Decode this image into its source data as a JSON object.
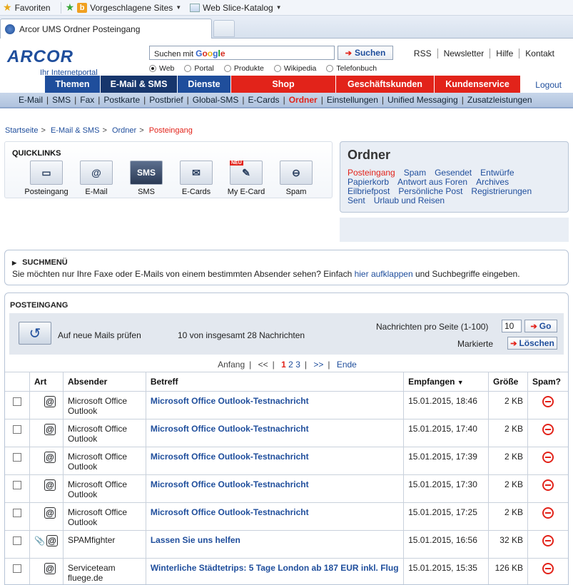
{
  "browser": {
    "favorites_label": "Favoriten",
    "suggested_sites": "Vorgeschlagene Sites",
    "web_slice": "Web Slice-Katalog",
    "tab_title": "Arcor UMS Ordner Posteingang"
  },
  "header": {
    "logo_text": "ARCOR",
    "logo_sub": "Ihr Internetportal",
    "search_prefix": "Suchen mit",
    "search_button": "Suchen",
    "radios": [
      "Web",
      "Portal",
      "Produkte",
      "Wikipedia",
      "Telefonbuch"
    ],
    "radio_selected": "Web",
    "top_links": [
      "RSS",
      "Newsletter",
      "Hilfe",
      "Kontakt"
    ],
    "nav": [
      "Themen",
      "E-Mail & SMS",
      "Dienste",
      "Shop",
      "Geschäftskunden",
      "Kundenservice"
    ],
    "logout": "Logout",
    "subnav": [
      "E-Mail",
      "SMS",
      "Fax",
      "Postkarte",
      "Postbrief",
      "Global-SMS",
      "E-Cards",
      "Ordner",
      "Einstellungen",
      "Unified Messaging",
      "Zusatzleistungen"
    ],
    "subnav_selected": "Ordner"
  },
  "breadcrumb": [
    "Startseite",
    "E-Mail & SMS",
    "Ordner",
    "Posteingang"
  ],
  "quicklinks": {
    "title": "QUICKLINKS",
    "items": [
      {
        "label": "Posteingang",
        "icon": "inbox-icon"
      },
      {
        "label": "E-Mail",
        "icon": "email-icon"
      },
      {
        "label": "SMS",
        "icon": "sms-icon"
      },
      {
        "label": "E-Cards",
        "icon": "ecard-icon"
      },
      {
        "label": "My E-Card",
        "icon": "my-ecard-icon",
        "badge": "NEU"
      },
      {
        "label": "Spam",
        "icon": "spam-icon"
      }
    ]
  },
  "ordner": {
    "title": "Ordner",
    "folders": [
      "Posteingang",
      "Spam",
      "Gesendet",
      "Entwürfe",
      "Papierkorb",
      "Antwort aus Foren",
      "Archives",
      "Eilbriefpost",
      "Persönliche Post",
      "Registrierungen",
      "Sent",
      "Urlaub und Reisen"
    ],
    "current": "Posteingang"
  },
  "suchmenu": {
    "title": "SUCHMENÜ",
    "text_before": "Sie möchten nur Ihre Faxe oder E-Mails von einem bestimmten Absender sehen? Einfach",
    "link": "hier aufklappen",
    "text_after": "und Suchbegriffe eingeben."
  },
  "inbox": {
    "title": "POSTEINGANG",
    "check_label": "Auf neue Mails prüfen",
    "count_text": "10 von insgesamt 28 Nachrichten",
    "per_page_label": "Nachrichten pro Seite (1-100)",
    "per_page_value": "10",
    "go_button": "Go",
    "marked_label": "Markierte",
    "delete_button": "Löschen",
    "pager": {
      "first": "Anfang",
      "prev": "<<",
      "pages": [
        "1",
        "2",
        "3"
      ],
      "current": "1",
      "next": ">>",
      "last": "Ende"
    },
    "columns": [
      "Art",
      "Absender",
      "Betreff",
      "Empfangen",
      "Größe",
      "Spam?"
    ],
    "sorted_column": "Empfangen",
    "rows": [
      {
        "attachment": false,
        "sender": "Microsoft Office Outlook",
        "subject": "Microsoft Office Outlook-Testnachricht",
        "received": "15.01.2015, 18:46",
        "size": "2 KB"
      },
      {
        "attachment": false,
        "sender": "Microsoft Office Outlook",
        "subject": "Microsoft Office Outlook-Testnachricht",
        "received": "15.01.2015, 17:40",
        "size": "2 KB"
      },
      {
        "attachment": false,
        "sender": "Microsoft Office Outlook",
        "subject": "Microsoft Office Outlook-Testnachricht",
        "received": "15.01.2015, 17:39",
        "size": "2 KB"
      },
      {
        "attachment": false,
        "sender": "Microsoft Office Outlook",
        "subject": "Microsoft Office Outlook-Testnachricht",
        "received": "15.01.2015, 17:30",
        "size": "2 KB"
      },
      {
        "attachment": false,
        "sender": "Microsoft Office Outlook",
        "subject": "Microsoft Office Outlook-Testnachricht",
        "received": "15.01.2015, 17:25",
        "size": "2 KB"
      },
      {
        "attachment": true,
        "sender": "SPAMfighter",
        "subject": "Lassen Sie uns helfen",
        "received": "15.01.2015, 16:56",
        "size": "32 KB"
      },
      {
        "attachment": false,
        "sender": "Serviceteam fluege.de",
        "subject": "Winterliche Städtetrips: 5 Tage London ab 187 EUR inkl. Flug",
        "received": "15.01.2015, 15:35",
        "size": "126 KB"
      }
    ]
  },
  "colors": {
    "brand_blue": "#1f4e9c",
    "brand_red": "#e2231a"
  }
}
